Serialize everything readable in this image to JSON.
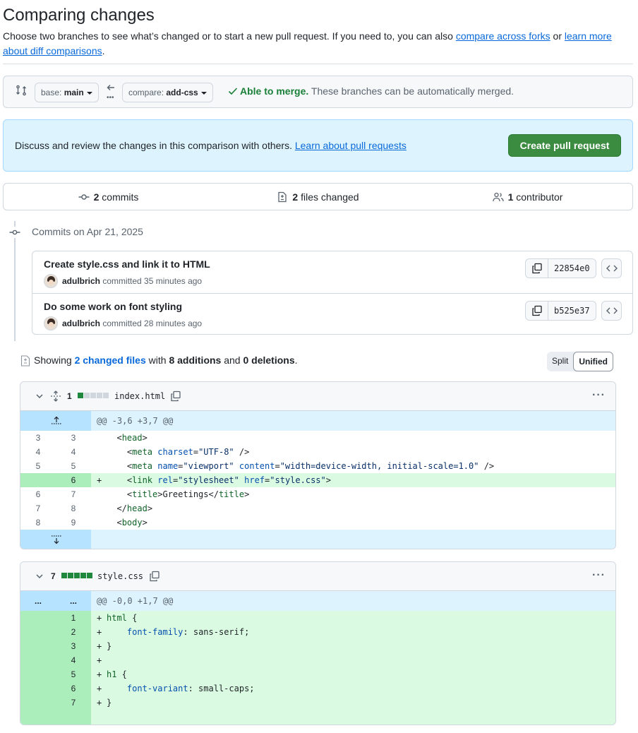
{
  "page": {
    "title": "Comparing changes",
    "lead_text": "Choose two branches to see what’s changed or to start a new pull request. If you need to, you can also ",
    "lead_link1": "compare across forks",
    "lead_mid": " or ",
    "lead_link2": "learn more about diff comparisons",
    "lead_end": "."
  },
  "range": {
    "base_key": "base:",
    "base_value": "main",
    "compare_key": "compare:",
    "compare_value": "add-css",
    "merge_ok": "Able to merge.",
    "merge_rest": " These branches can be automatically merged."
  },
  "discuss": {
    "text": "Discuss and review the changes in this comparison with others. ",
    "link": "Learn about pull requests",
    "button": "Create pull request"
  },
  "summary": {
    "commits_count": "2",
    "commits_label": "commits",
    "files_count": "2",
    "files_label": "files changed",
    "contributors_count": "1",
    "contributors_label": "contributor"
  },
  "commits": {
    "date_label": "Commits on Apr 21, 2025",
    "items": [
      {
        "title": "Create style.css and link it to HTML",
        "author": "adulbrich",
        "meta": "committed 35 minutes ago",
        "sha": "22854e0"
      },
      {
        "title": "Do some work on font styling",
        "author": "adulbrich",
        "meta": "committed 28 minutes ago",
        "sha": "b525e37"
      }
    ]
  },
  "diff_summary": {
    "prefix": "Showing ",
    "files_link": "2 changed files",
    "mid1": " with ",
    "additions": "8 additions",
    "mid2": " and ",
    "deletions": "0 deletions",
    "end": ".",
    "split": "Split",
    "unified": "Unified"
  },
  "files": [
    {
      "count": "1",
      "name": "index.html",
      "diffstat": [
        1,
        0,
        0,
        0,
        0
      ],
      "hunk": "@@ -3,6 +3,7 @@",
      "lines": [
        {
          "old": "3",
          "new": "3",
          "type": "ctx"
        },
        {
          "old": "4",
          "new": "4",
          "type": "ctx"
        },
        {
          "old": "5",
          "new": "5",
          "type": "ctx"
        },
        {
          "old": "",
          "new": "6",
          "type": "add"
        },
        {
          "old": "6",
          "new": "7",
          "type": "ctx"
        },
        {
          "old": "7",
          "new": "8",
          "type": "ctx"
        },
        {
          "old": "8",
          "new": "9",
          "type": "ctx"
        }
      ]
    },
    {
      "count": "7",
      "name": "style.css",
      "diffstat": [
        1,
        1,
        1,
        1,
        1
      ],
      "hunk": "@@ -0,0 +1,7 @@",
      "hunk_dots": "...",
      "lines": [
        {
          "new": "1",
          "text": "html {"
        },
        {
          "new": "2",
          "text": "    font-family: sans-serif;"
        },
        {
          "new": "3",
          "text": "}"
        },
        {
          "new": "4",
          "text": ""
        },
        {
          "new": "5",
          "text": "h1 {"
        },
        {
          "new": "6",
          "text": "    font-variant: small-caps;"
        },
        {
          "new": "7",
          "text": "}"
        }
      ]
    }
  ],
  "colors": {
    "accent": "#0969da",
    "success": "#1a7f37",
    "button_green": "#3b8c40",
    "add_bg": "#dafbe1",
    "add_gutter": "#aceebb",
    "hunk_bg": "#ddf4ff"
  }
}
